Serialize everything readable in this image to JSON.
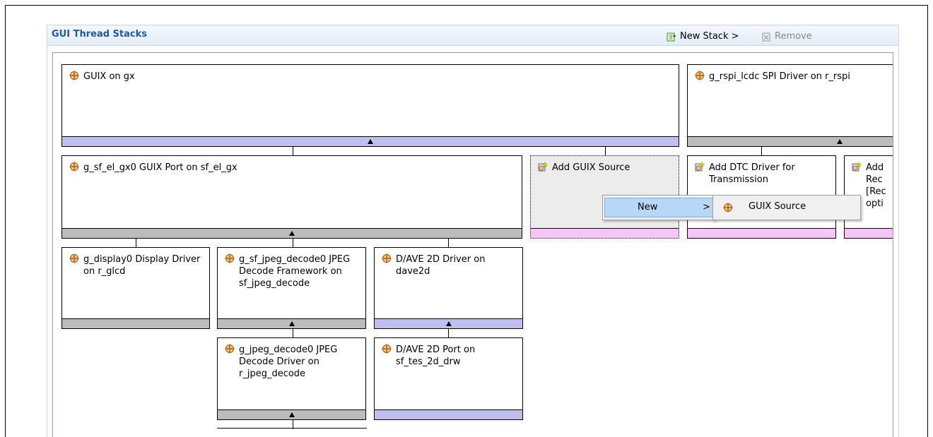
{
  "panel": {
    "title": "GUI Thread Stacks",
    "new_stack_label": "New Stack >",
    "remove_label": "Remove"
  },
  "nodes": {
    "guix": "GUIX on gx",
    "rspi": "g_rspi_lcdc SPI Driver on r_rspi",
    "sf_el_gx": "g_sf_el_gx0 GUIX Port on sf_el_gx",
    "add_guix_source": "Add GUIX Source",
    "add_dtc_tx": "Add DTC Driver for Transmission",
    "add_partial_line1": "Add",
    "add_partial_line2": "Rec",
    "add_partial_line3": "[Rec",
    "add_partial_line4": "opti",
    "display0": "g_display0 Display Driver on r_glcd",
    "jpeg_framework": "g_sf_jpeg_decode0 JPEG Decode Framework on sf_jpeg_decode",
    "dave2d_driver": "D/AVE 2D Driver on dave2d",
    "jpeg_driver": "g_jpeg_decode0 JPEG Decode Driver on r_jpeg_decode",
    "dave2d_port": "D/AVE 2D Port on sf_tes_2d_drw"
  },
  "context_menu": {
    "new_label": "New",
    "arrow": ">",
    "submenu_item": "GUIX Source"
  },
  "colors": {
    "bar_gray": "#bcbcbc",
    "bar_blue": "#bfbff0",
    "bar_pink": "#f7c4f7",
    "menu_highlight": "#b8d7f5",
    "title_blue": "#1e5aa0"
  }
}
